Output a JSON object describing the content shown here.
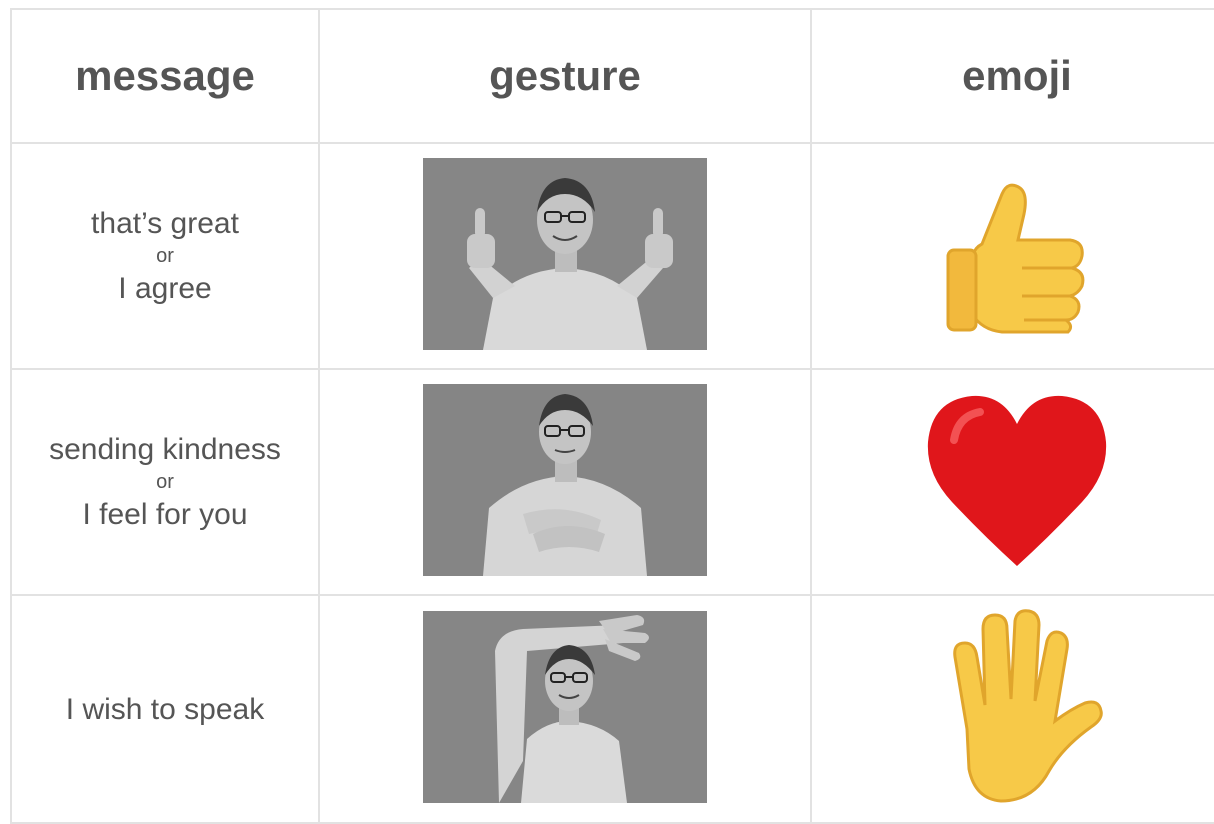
{
  "headers": {
    "message": "message",
    "gesture": "gesture",
    "emoji": "emoji"
  },
  "rows": [
    {
      "message_line1": "that’s great",
      "or": "or",
      "message_line2": "I agree",
      "gesture_icon": "thumbs-up-gesture-photo",
      "emoji_icon": "thumbs-up-icon"
    },
    {
      "message_line1": "sending kindness",
      "or": "or",
      "message_line2": "I feel for you",
      "gesture_icon": "hand-on-heart-gesture-photo",
      "emoji_icon": "heart-icon"
    },
    {
      "message_line1": "I wish to speak",
      "gesture_icon": "raised-hand-gesture-photo",
      "emoji_icon": "raised-hand-icon"
    }
  ],
  "colors": {
    "text": "#555555",
    "border": "#e2e2e2",
    "photo_bg": "#8a8a8a",
    "emoji_yellow": "#f7c948",
    "heart_red": "#e0161b"
  }
}
